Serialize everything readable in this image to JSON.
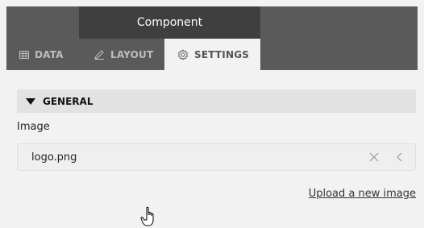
{
  "window": {
    "title": "Component"
  },
  "tabs": [
    {
      "label": "DATA",
      "icon": "table-icon",
      "active": false
    },
    {
      "label": "LAYOUT",
      "icon": "pencil-icon",
      "active": false
    },
    {
      "label": "SETTINGS",
      "icon": "gear-icon",
      "active": true
    }
  ],
  "section": {
    "label": "GENERAL",
    "expanded": true
  },
  "image_field": {
    "label": "Image",
    "value": "logo.png",
    "clear_icon": "close-icon",
    "back_icon": "chevron-left-icon"
  },
  "upload_link": {
    "label": "Upload a new image"
  },
  "colors": {
    "header_bg": "#5a5a5a",
    "title_bg": "#3f3f3f",
    "active_tab_bg": "#f2f2f2",
    "panel_bg": "#f2f2f2",
    "section_bg": "#e2e2e2"
  }
}
